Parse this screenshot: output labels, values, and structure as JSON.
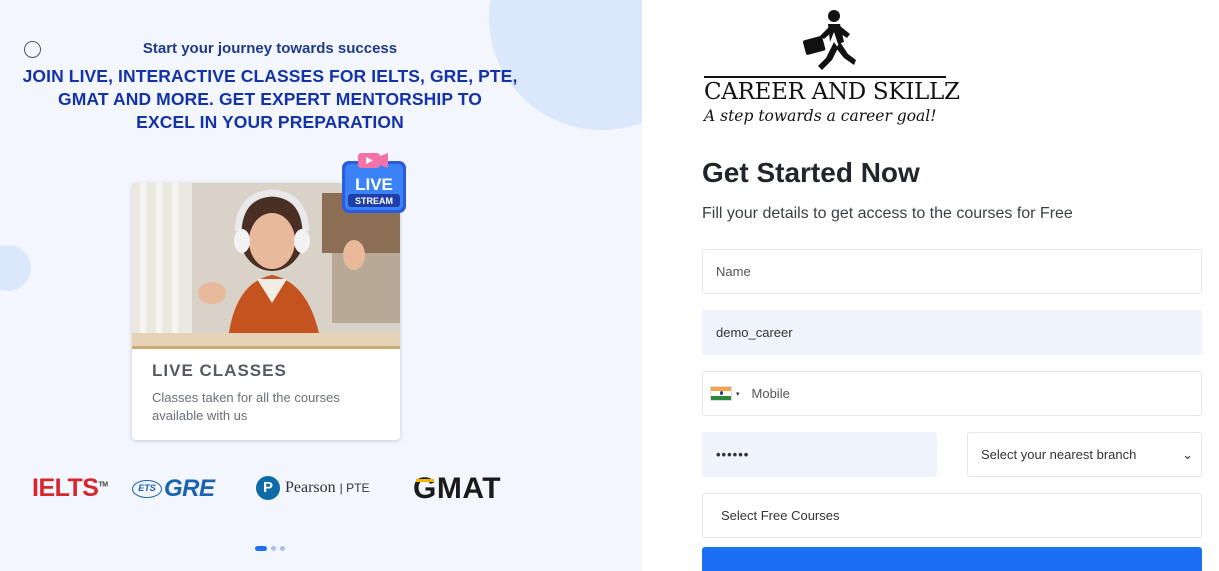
{
  "promo": {
    "tagline": "Start your journey towards success",
    "headline_lines": [
      "JOIN LIVE, INTERACTIVE CLASSES FOR IELTS, GRE, PTE,",
      "GMAT AND MORE. GET EXPERT MENTORSHIP TO",
      "EXCEL IN YOUR PREPARATION"
    ],
    "card": {
      "badge_top": "LIVE",
      "badge_bottom": "STREAM",
      "title": "LIVE CLASSES",
      "description": "Classes taken for all the courses available with us"
    },
    "logos": {
      "ielts": "IELTS",
      "ielts_tm": "TM",
      "ets": "ETS",
      "gre": "GRE",
      "pearson_initial": "P",
      "pearson": "Pearson",
      "pte": "| PTE",
      "gmat_g": "G",
      "gmat_rest": "MAT"
    },
    "carousel": {
      "count": 3,
      "active": 1
    }
  },
  "brand": {
    "name": "CAREER AND SKILLZ",
    "tagline": "A step towards a career goal!"
  },
  "form": {
    "heading": "Get Started Now",
    "subheading": "Fill your details to get access to the courses for Free",
    "name_placeholder": "Name",
    "username_value": "demo_career",
    "country_caret": "▾",
    "mobile_placeholder": "Mobile",
    "password_value": "••••••",
    "branch_select": "Select your nearest branch",
    "branch_chevron": "⌄",
    "courses_select": "Select Free Courses"
  },
  "colors": {
    "accent": "#1c6ef2",
    "headline": "#1433a8",
    "panel_bg": "#f3f6fd"
  }
}
